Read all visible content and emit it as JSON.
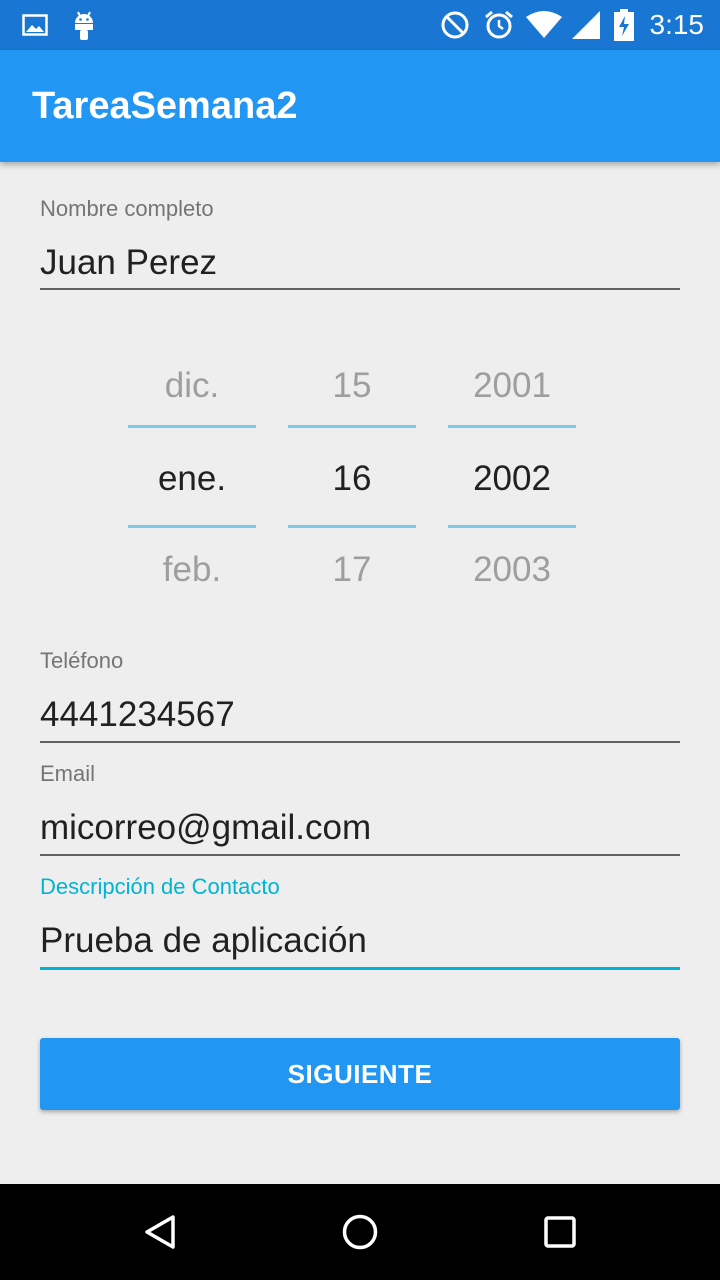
{
  "status_bar": {
    "time": "3:15",
    "icons": [
      "image-icon",
      "android-icon",
      "do-not-disturb-icon",
      "alarm-icon",
      "wifi-icon",
      "signal-icon",
      "battery-charging-icon"
    ]
  },
  "app_bar": {
    "title": "TareaSemana2"
  },
  "form": {
    "name": {
      "label": "Nombre completo",
      "value": "Juan Perez"
    },
    "date_picker": {
      "month": {
        "prev": "dic.",
        "selected": "ene.",
        "next": "feb."
      },
      "day": {
        "prev": "15",
        "selected": "16",
        "next": "17"
      },
      "year": {
        "prev": "2001",
        "selected": "2002",
        "next": "2003"
      }
    },
    "phone": {
      "label": "Teléfono",
      "value": "4441234567"
    },
    "email": {
      "label": "Email",
      "value": "micorreo@gmail.com"
    },
    "description": {
      "label": "Descripción de Contacto",
      "value": "Prueba de aplicación",
      "focused": true
    }
  },
  "button": {
    "label": "SIGUIENTE"
  },
  "nav_bar": {
    "buttons": [
      "back-icon",
      "home-icon",
      "recents-icon"
    ]
  },
  "colors": {
    "status_bar": "#1976d2",
    "app_bar": "#2196f3",
    "accent": "#00b4d4",
    "background": "#eeeeee"
  }
}
